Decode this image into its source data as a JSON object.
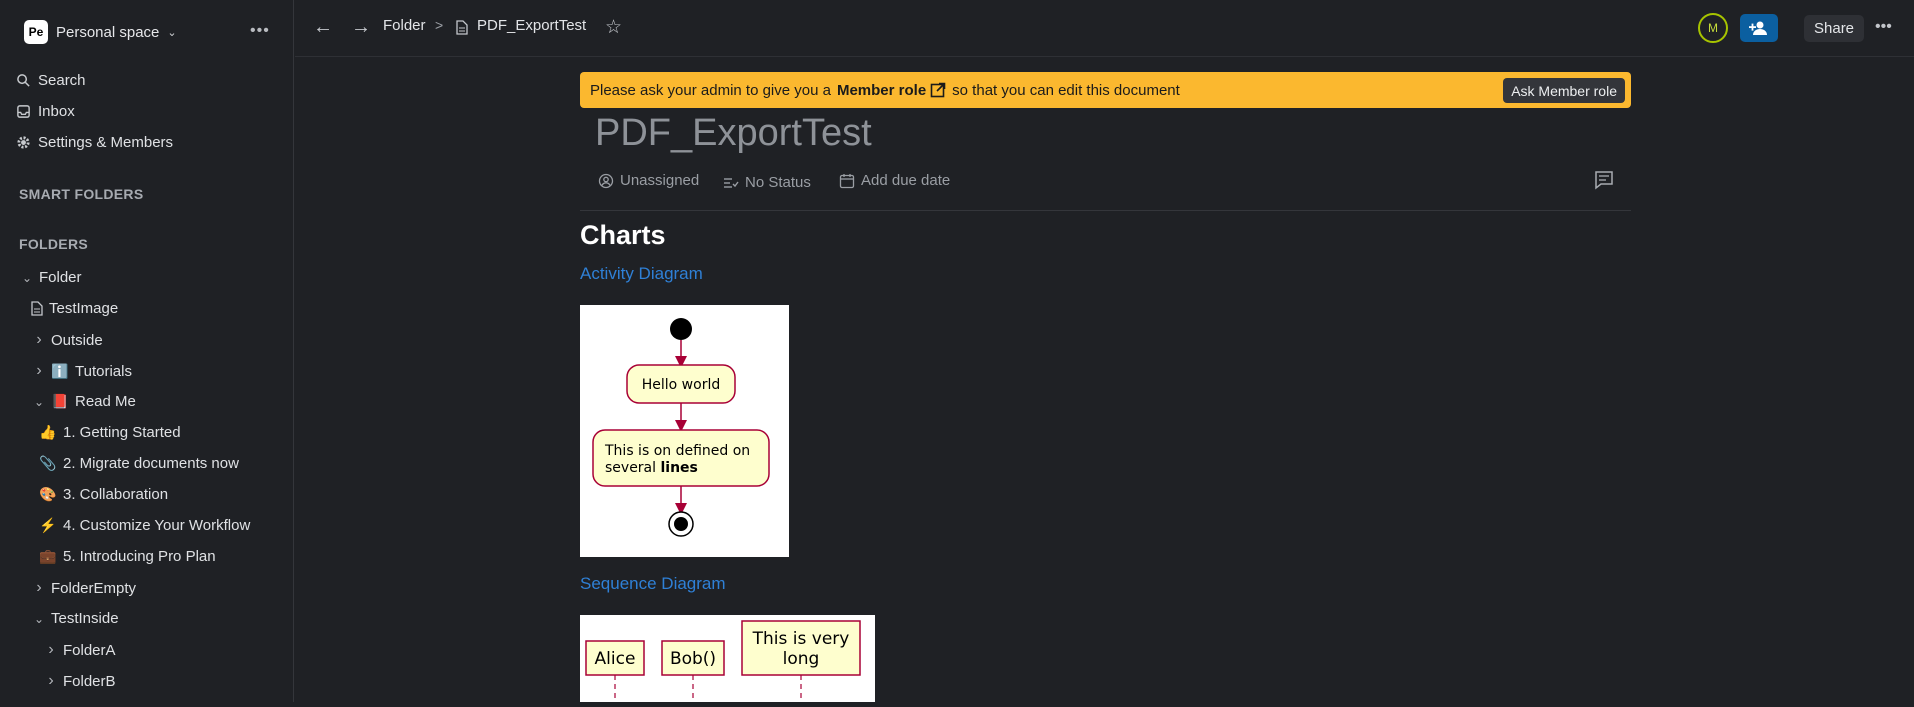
{
  "workspace": {
    "badge": "Pe",
    "name": "Personal space"
  },
  "nav": {
    "search": "Search",
    "inbox": "Inbox",
    "settings": "Settings & Members"
  },
  "sections": {
    "smart_folders": "SMART FOLDERS",
    "folders": "FOLDERS"
  },
  "tree": [
    {
      "label": "Folder",
      "caret": "down",
      "icon": ""
    },
    {
      "label": "TestImage",
      "caret": "",
      "icon": "doc"
    },
    {
      "label": "Outside",
      "caret": "right",
      "icon": ""
    },
    {
      "label": "Tutorials",
      "caret": "right",
      "icon": "ℹ️"
    },
    {
      "label": "Read Me",
      "caret": "down",
      "icon": "📕"
    },
    {
      "label": "1. Getting Started",
      "caret": "",
      "icon": "👍"
    },
    {
      "label": "2. Migrate documents now",
      "caret": "",
      "icon": "📎"
    },
    {
      "label": "3. Collaboration",
      "caret": "",
      "icon": "🎨"
    },
    {
      "label": "4. Customize Your Workflow",
      "caret": "",
      "icon": "⚡"
    },
    {
      "label": "5. Introducing Pro Plan",
      "caret": "",
      "icon": "💼"
    },
    {
      "label": "FolderEmpty",
      "caret": "right",
      "icon": ""
    },
    {
      "label": "TestInside",
      "caret": "down",
      "icon": ""
    },
    {
      "label": "FolderA",
      "caret": "right",
      "icon": ""
    },
    {
      "label": "FolderB",
      "caret": "right",
      "icon": ""
    }
  ],
  "topbar": {
    "crumb_folder": "Folder",
    "crumb_doc": "PDF_ExportTest",
    "avatar_initial": "M",
    "share": "Share"
  },
  "banner": {
    "before": "Please ask your admin to give you a",
    "role": "Member role",
    "after": "so that you can edit this document",
    "button": "Ask Member role"
  },
  "doc": {
    "title": "PDF_ExportTest",
    "assignee": "Unassigned",
    "status": "No Status",
    "due": "Add due date",
    "heading": "Charts",
    "link1": "Activity Diagram",
    "link2": "Sequence Diagram"
  },
  "activity": {
    "node1": "Hello world",
    "node2_line1": "This is on defined on",
    "node2_line2a": "several ",
    "node2_line2b": "lines"
  },
  "sequence": {
    "actor1": "Alice",
    "actor2": "Bob()",
    "actor3_line1": "This is very",
    "actor3_line2": "long"
  },
  "colors": {
    "banner": "#fbb82f",
    "link": "#2f80d6",
    "diagram_border": "#a80036",
    "diagram_fill": "#fefece"
  }
}
